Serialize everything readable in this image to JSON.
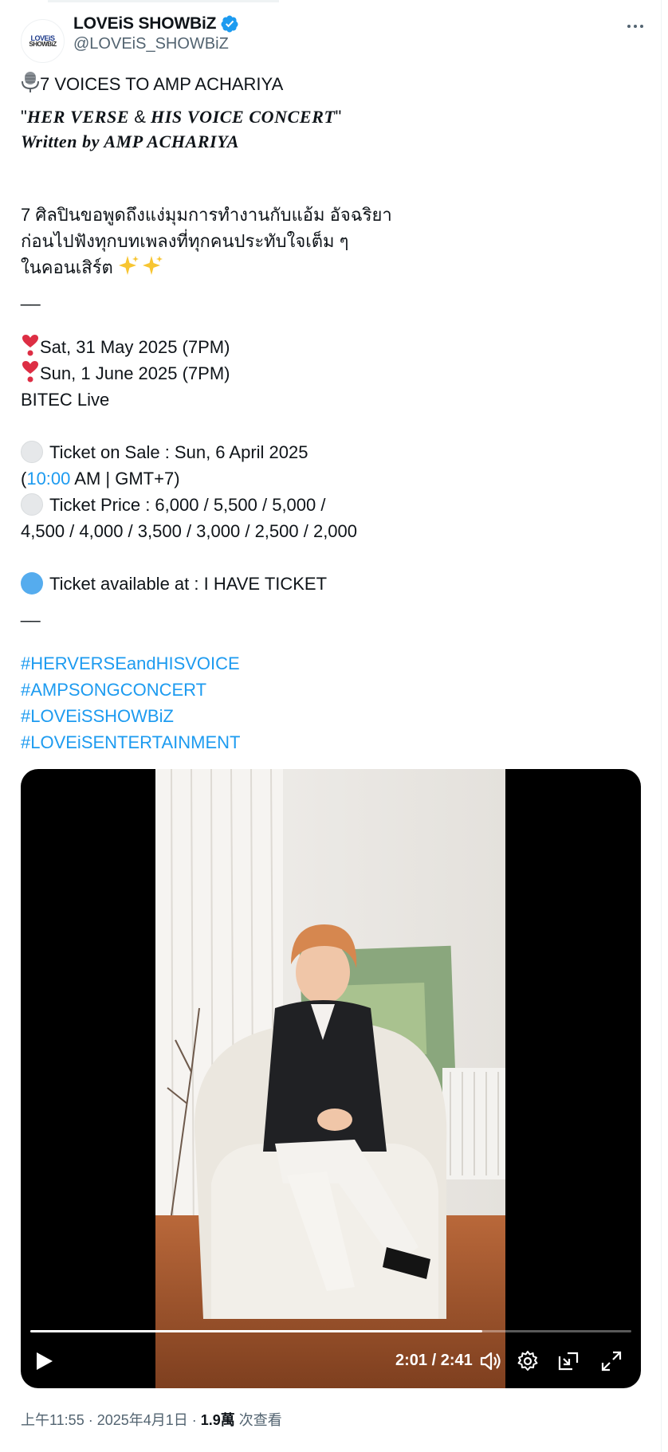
{
  "tweet": {
    "author": {
      "display_name": "LOVEiS SHOWBiZ",
      "handle": "@LOVEiS_SHOWBiZ",
      "avatar_text_top": "LOVEiS",
      "avatar_text_bottom": "SHOWBiZ",
      "verified": true,
      "verified_color": "#1d9bf0"
    },
    "headline": "7 VOICES TO AMP ACHARIYA",
    "title_quote_open": "\"",
    "title_part1": "HER VERSE",
    "title_amp": " & ",
    "title_part2": "HIS VOICE CONCERT",
    "title_quote_close": "\"",
    "written_by": "Written by AMP ACHARIYA",
    "thai_lines": [
      "7 ศิลปินขอพูดถึงแง่มุมการทำงานกับแอ้ม อัจฉริยา",
      "ก่อนไปฟังทุกบทเพลงที่ทุกคนประทับใจเต็ม ๆ",
      "ในคอนเสิร์ต"
    ],
    "divider_1": "__",
    "date_1": "Sat, 31 May 2025 (7PM)",
    "date_2": "Sun, 1 June 2025 (7PM)",
    "venue": "BITEC Live",
    "sale_label": "Ticket on Sale : Sun, 6 April 2025",
    "sale_time_open": "(",
    "sale_time_link": "10:00",
    "sale_time_rest": " AM | GMT+7)",
    "price_line_1": "Ticket Price : 6,000 / 5,500 / 5,000 /",
    "price_line_2": "4,500 / 4,000 / 3,500 / 3,000 / 2,500 / 2,000",
    "available": "Ticket available at : I HAVE TICKET",
    "divider_2": "__",
    "hashtags": [
      "#HERVERSEandHISVOICE",
      "#AMPSONGCONCERT",
      "#LOVEiSSHOWBiZ",
      "#LOVEiSENTERTAINMENT"
    ],
    "link_color": "#1d9bf0"
  },
  "video": {
    "time_display": "2:01 / 2:41",
    "progress": 0.752,
    "icons": [
      "play-icon",
      "volume-icon",
      "settings-icon",
      "picture-in-picture-icon",
      "fullscreen-icon"
    ]
  },
  "footer": {
    "time_date": "上午11:55 · 2025年4月1日 · ",
    "views_count": "1.9萬",
    "views_label": " 次查看"
  }
}
